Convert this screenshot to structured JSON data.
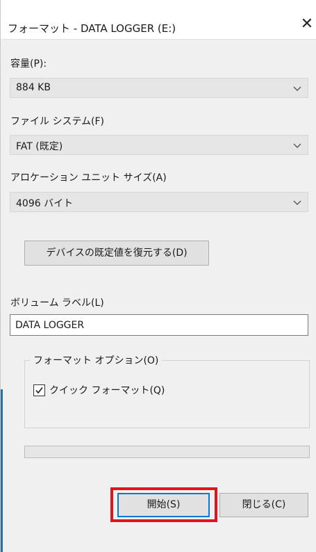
{
  "window": {
    "title": "フォーマット - DATA LOGGER (E:)",
    "close_glyph": "✕"
  },
  "capacity": {
    "label": "容量(P):",
    "value": "884 KB"
  },
  "file_system": {
    "label": "ファイル システム(F)",
    "value": "FAT (既定)"
  },
  "allocation_unit": {
    "label": "アロケーション ユニット サイズ(A)",
    "value": "4096 バイト"
  },
  "restore_defaults_label": "デバイスの既定値を復元する(D)",
  "volume_label": {
    "label": "ボリューム ラベル(L)",
    "value": "DATA LOGGER"
  },
  "format_options": {
    "legend": "フォーマット オプション(O)",
    "quick_format": {
      "label": "クイック フォーマット(Q)",
      "checked": true
    }
  },
  "progress": {
    "fraction": 0
  },
  "buttons": {
    "start": "開始(S)",
    "close": "閉じる(C)"
  },
  "colors": {
    "highlight": "#e0141e",
    "default_button_border": "#0078d7",
    "left_accent": "#2b6f9e"
  },
  "icons": {
    "dropdown": "chevron-down-icon",
    "close": "close-icon",
    "check": "checkmark-icon"
  }
}
